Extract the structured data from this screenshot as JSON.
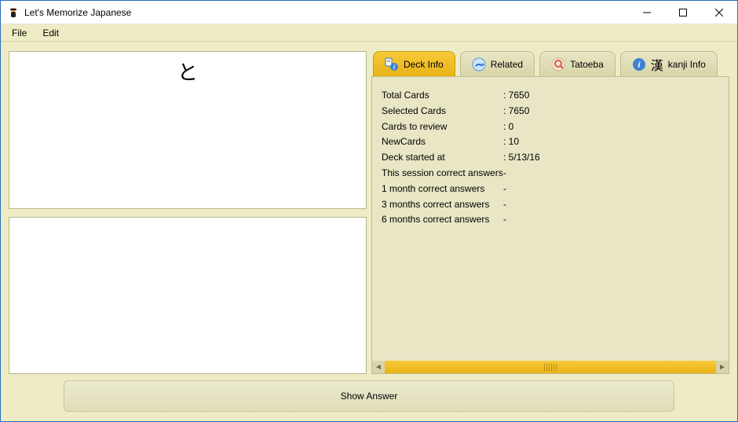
{
  "window": {
    "title": "Let's Memorize Japanese"
  },
  "menu": {
    "file": "File",
    "edit": "Edit"
  },
  "card": {
    "front_text": "と"
  },
  "tabs": {
    "deck_info": "Deck Info",
    "related": "Related",
    "tatoeba": "Tatoeba",
    "kanji_info": "kanji Info"
  },
  "deck_info": {
    "rows": [
      {
        "label": "Total Cards",
        "value": ": 7650"
      },
      {
        "label": "Selected Cards",
        "value": ": 7650"
      },
      {
        "label": "Cards to review",
        "value": ": 0"
      },
      {
        "label": "NewCards",
        "value": ": 10"
      },
      {
        "label": "Deck started at",
        "value": ": 5/13/16"
      },
      {
        "label": "This session correct answers",
        "value": "   -"
      },
      {
        "label": "1 month correct answers",
        "value": "   -"
      },
      {
        "label": "3 months correct answers",
        "value": "   -"
      },
      {
        "label": "6 months correct answers",
        "value": "   -"
      }
    ]
  },
  "footer": {
    "show_answer": "Show Answer"
  },
  "icons": {
    "kanji_glyph": "漢"
  }
}
